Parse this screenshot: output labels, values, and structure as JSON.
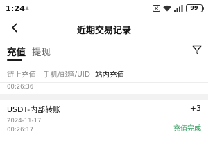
{
  "status_bar": {
    "time": "1:24",
    "dot": "▲",
    "battery": "99"
  },
  "nav": {
    "title": "近期交易记录"
  },
  "tabs": [
    {
      "label": "充值",
      "active": true
    },
    {
      "label": "提现",
      "active": false
    }
  ],
  "subtabs": [
    {
      "label": "链上充值",
      "active": false
    },
    {
      "label": "手机/邮箱/UID",
      "active": false
    },
    {
      "label": "站内充值",
      "active": true
    }
  ],
  "records": [
    {
      "time": "00:26:36"
    },
    {
      "title": "USDT-内部转账",
      "amount": "+3",
      "date": "2024-11-17",
      "time": "00:26:17",
      "status": "充值完成",
      "status_color": "#2e9a5a"
    }
  ]
}
